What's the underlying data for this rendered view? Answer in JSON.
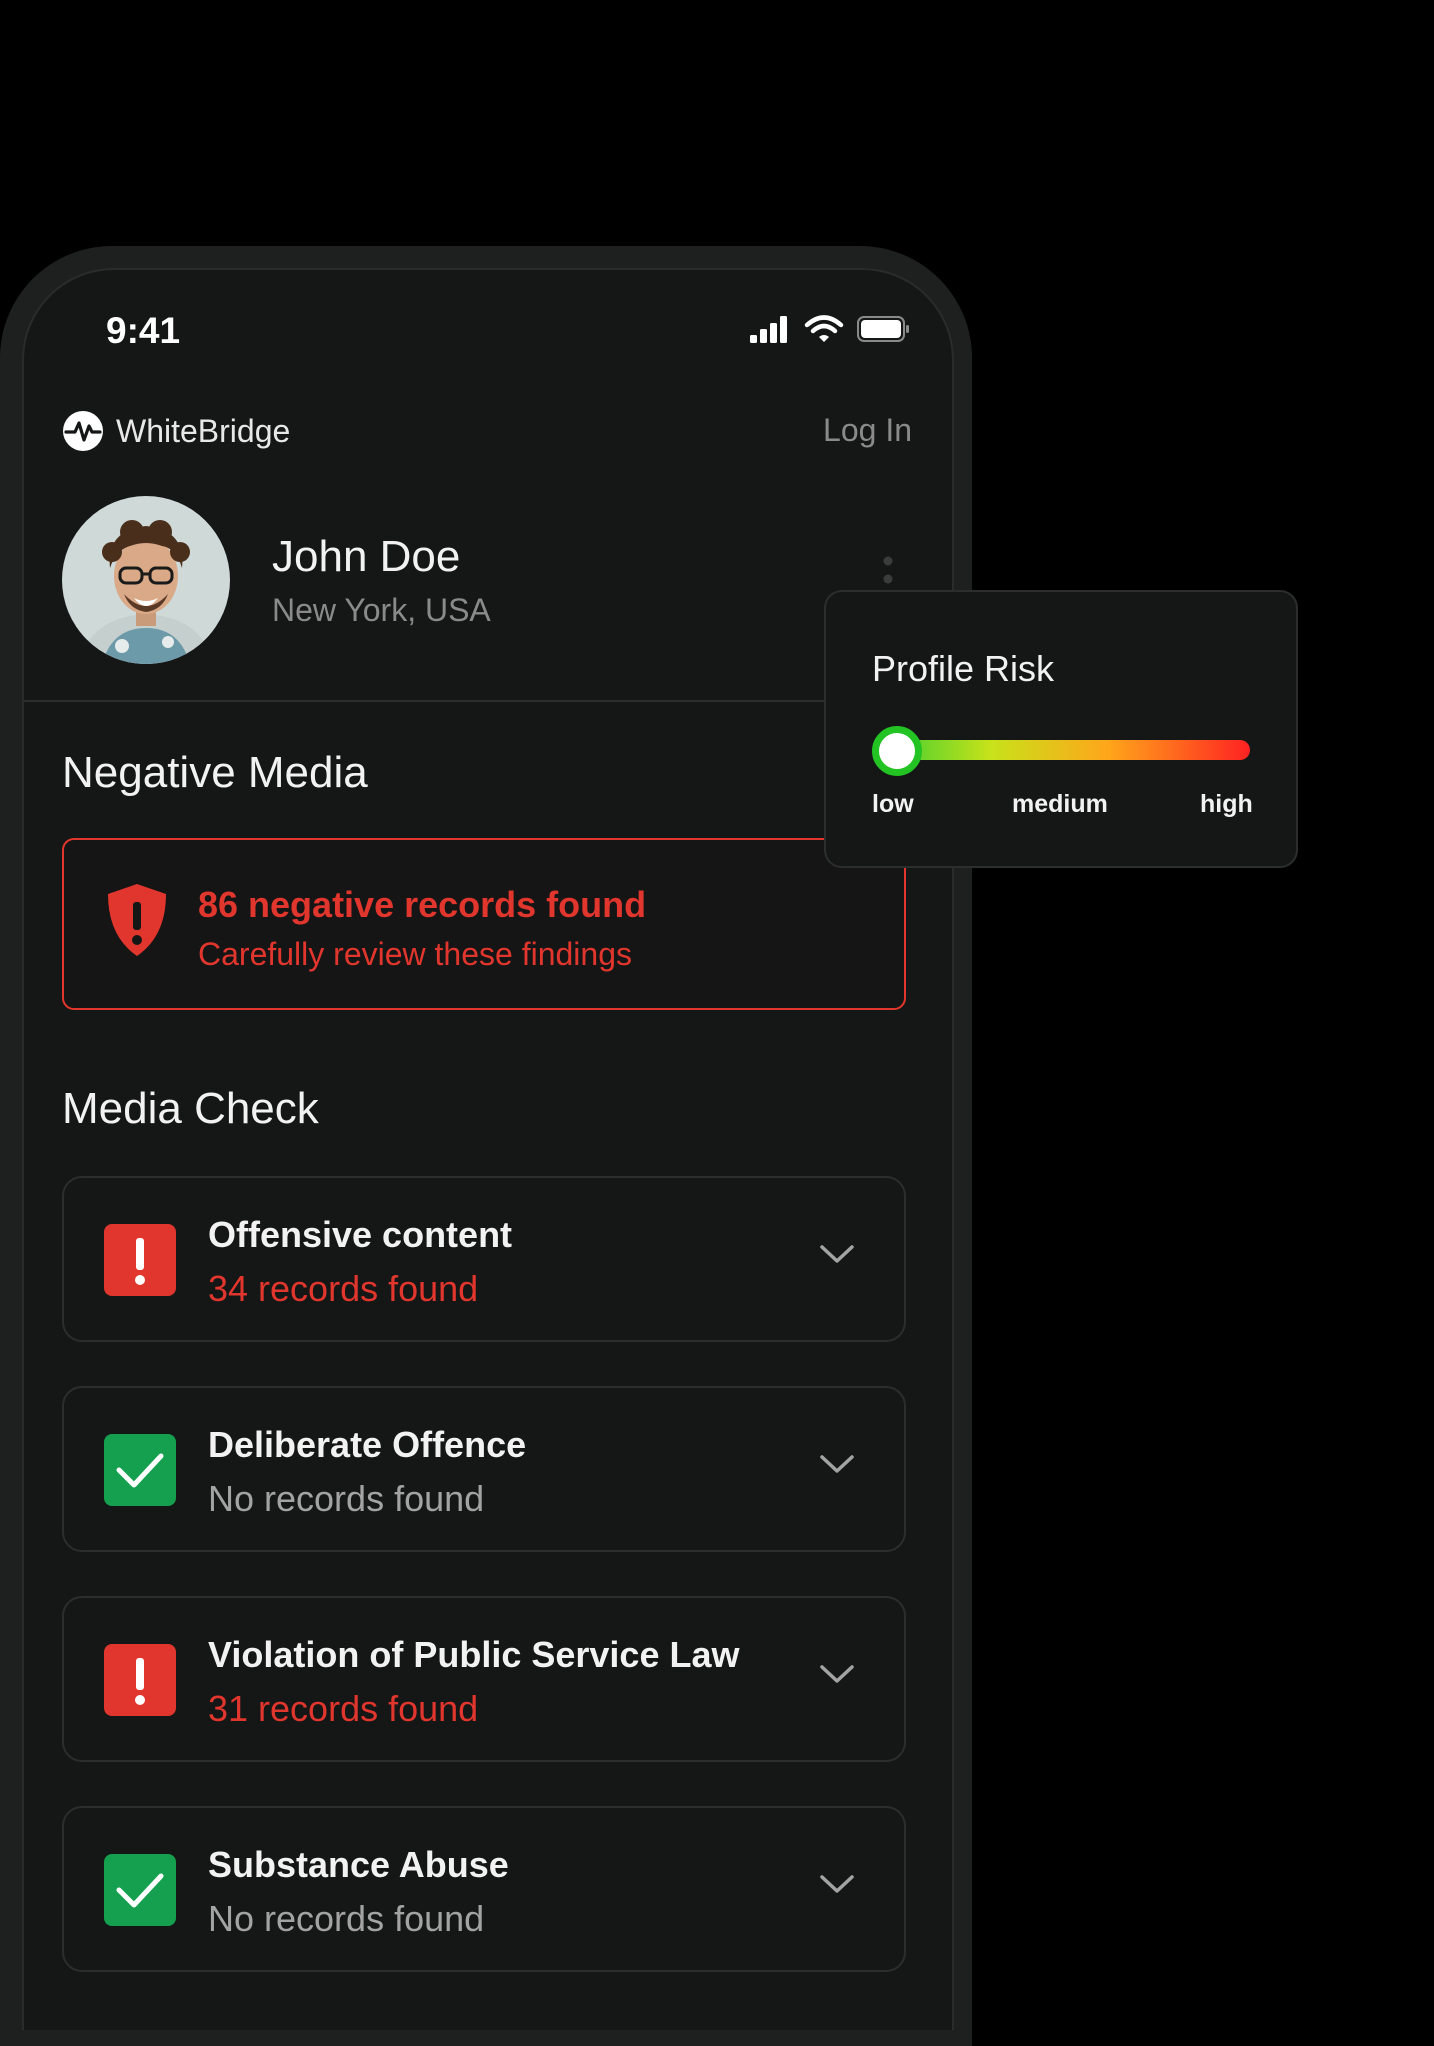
{
  "status_bar": {
    "time": "9:41"
  },
  "header": {
    "brand": "WhiteBridge",
    "login": "Log In"
  },
  "profile": {
    "name": "John Doe",
    "location": "New York, USA"
  },
  "negative_media": {
    "heading": "Negative Media",
    "alert_title": "86 negative records found",
    "alert_subtitle": "Carefully review these findings"
  },
  "media_check": {
    "heading": "Media Check",
    "items": [
      {
        "title": "Offensive content",
        "status": "34 records found",
        "level": "negative"
      },
      {
        "title": "Deliberate Offence",
        "status": "No records found",
        "level": "clear"
      },
      {
        "title": "Violation of Public Service Law",
        "status": "31 records found",
        "level": "negative"
      },
      {
        "title": "Substance Abuse",
        "status": "No records found",
        "level": "clear"
      }
    ]
  },
  "profile_risk": {
    "title": "Profile Risk",
    "labels": {
      "low": "low",
      "medium": "medium",
      "high": "high"
    },
    "level": "low"
  },
  "colors": {
    "alert_red": "#e0362d",
    "ok_green": "#14a04e",
    "background": "#151616"
  }
}
